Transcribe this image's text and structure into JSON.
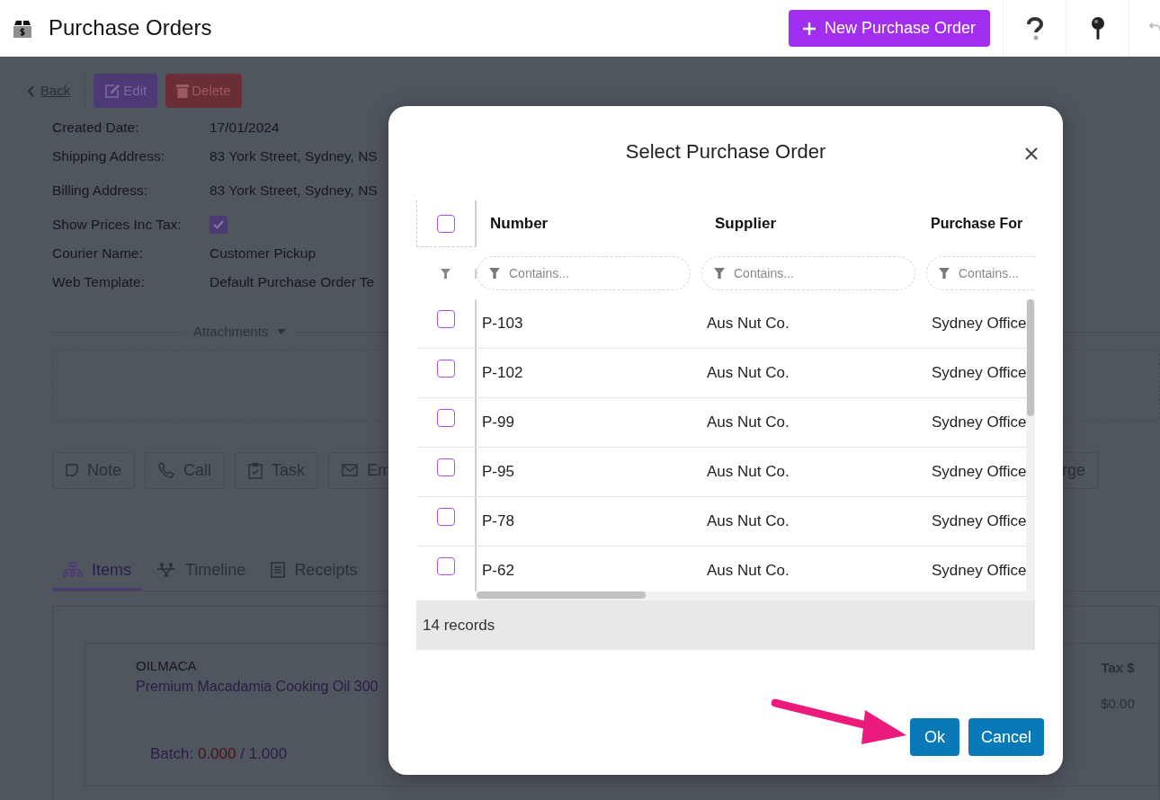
{
  "header": {
    "title": "Purchase Orders",
    "new_button": "New Purchase Order"
  },
  "background": {
    "back": "Back",
    "edit": "Edit",
    "delete": "Delete",
    "fields": [
      {
        "label": "Created Date:",
        "kind": "text",
        "value": "17/01/2024"
      },
      {
        "label": "Shipping Address:",
        "kind": "text",
        "value": "83 York Street, Sydney, NS"
      },
      {
        "label": "Billing Address:",
        "kind": "text",
        "value": "83 York Street, Sydney, NS"
      },
      {
        "label": "Show Prices Inc Tax:",
        "kind": "checkbox",
        "checked": true
      },
      {
        "label": "Courier Name:",
        "kind": "text",
        "value": "Customer Pickup"
      },
      {
        "label": "Web Template:",
        "kind": "text",
        "value": "Default Purchase Order Te"
      }
    ],
    "attachments": "Attachments",
    "actions": [
      {
        "label": "Note",
        "kind": "note"
      },
      {
        "label": "Call",
        "kind": "call"
      },
      {
        "label": "Task",
        "kind": "task"
      },
      {
        "label": "Em",
        "kind": "email"
      }
    ],
    "action_right": "rge",
    "tabs": [
      {
        "label": "Items",
        "kind": "items",
        "selected": true
      },
      {
        "label": "Timeline",
        "kind": "timeline",
        "selected": false
      },
      {
        "label": "Receipts",
        "kind": "receipts",
        "selected": false
      }
    ],
    "item": {
      "code": "OILMACA",
      "name": "Premium Macadamia Cooking Oil 300",
      "batch_label": "Batch:",
      "batch_received": "0.000",
      "batch_total": "/ 1.000"
    },
    "tax": {
      "header": "Tax $",
      "value": "$0.00"
    }
  },
  "modal": {
    "title": "Select Purchase Order",
    "all_checked": false,
    "columns": [
      {
        "label": "Number",
        "placeholder": "Contains..."
      },
      {
        "label": "Supplier",
        "placeholder": "Contains..."
      },
      {
        "label": "Purchase For",
        "placeholder": "Contains..."
      }
    ],
    "rows": [
      {
        "number": "P-103",
        "supplier": "Aus Nut Co.",
        "purchase_for": "Sydney Office",
        "checked": false
      },
      {
        "number": "P-102",
        "supplier": "Aus Nut Co.",
        "purchase_for": "Sydney Office",
        "checked": false
      },
      {
        "number": "P-99",
        "supplier": "Aus Nut Co.",
        "purchase_for": "Sydney Office",
        "checked": false
      },
      {
        "number": "P-95",
        "supplier": "Aus Nut Co.",
        "purchase_for": "Sydney Office",
        "checked": false
      },
      {
        "number": "P-78",
        "supplier": "Aus Nut Co.",
        "purchase_for": "Sydney Office",
        "checked": false
      },
      {
        "number": "P-62",
        "supplier": "Aus Nut Co.",
        "purchase_for": "Sydney Office",
        "checked": false
      }
    ],
    "records": "14 records",
    "ok": "Ok",
    "cancel": "Cancel"
  }
}
